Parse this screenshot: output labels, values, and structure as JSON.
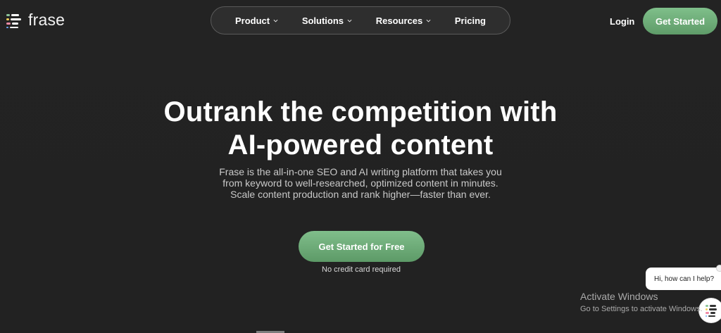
{
  "header": {
    "brand": {
      "name": "frase",
      "logo_icon": "frase-logo-icon"
    },
    "nav": [
      {
        "label": "Product",
        "has_dropdown": true,
        "icon": "chevron-down-icon"
      },
      {
        "label": "Solutions",
        "has_dropdown": true,
        "icon": "chevron-down-icon"
      },
      {
        "label": "Resources",
        "has_dropdown": true,
        "icon": "chevron-down-icon"
      },
      {
        "label": "Pricing",
        "has_dropdown": false
      }
    ],
    "login_label": "Login",
    "cta_label": "Get Started"
  },
  "hero": {
    "title_line_1": "Outrank the competition with",
    "title_line_2": "AI-powered content",
    "subtitle_line_1": "Frase is the all-in-one SEO and AI writing platform that takes you",
    "subtitle_line_2": "from keyword to well-researched, optimized content in minutes.",
    "subtitle_line_3": "Scale content production and rank higher—faster than ever.",
    "cta_label": "Get Started for Free",
    "note": "No credit card required"
  },
  "chat": {
    "greeting": "Hi, how can I help?",
    "close_icon": "close-icon",
    "launcher_icon": "chat-launcher-icon"
  },
  "watermark": {
    "title": "Activate Windows",
    "subtitle": "Go to Settings to activate Windows."
  },
  "colors": {
    "background": "#232323",
    "accent_green": "#6fae7a",
    "text_primary": "#ffffff",
    "text_secondary": "#c9c9c9"
  }
}
